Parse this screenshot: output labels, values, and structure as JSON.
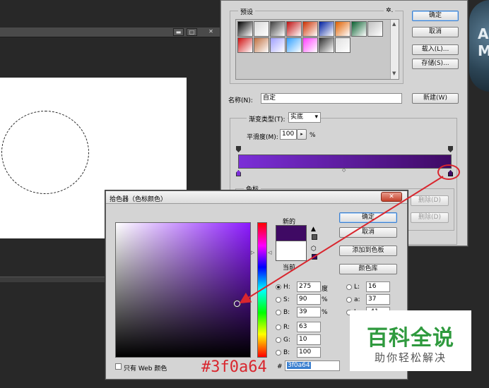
{
  "workspace": {
    "window_buttons": [
      "▬",
      "□",
      "✕"
    ]
  },
  "emblem": {
    "letters": "A M"
  },
  "gradient_editor": {
    "presets_label": "预设",
    "gear_symbol": "✲.",
    "buttons": {
      "ok": "确定",
      "cancel": "取消",
      "load": "载入(L)...",
      "save": "存储(S)...",
      "new": "新建(W)"
    },
    "name_label": "名称(N):",
    "name_value": "自定",
    "gradient_type_label": "渐变类型(T):",
    "gradient_type_value": "实底",
    "smoothness_label": "平滑度(M):",
    "smoothness_value": "100",
    "smoothness_unit": "%",
    "color_stops_label": "色标",
    "delete_label": "删除(D)",
    "swatches": [
      [
        "#000000",
        "#d8d8d8",
        "#404040",
        "#c01010",
        "#cc3000",
        "#0020a0",
        "#e06000",
        "#0a6030",
        "#c0c0c0"
      ],
      [
        "#d01010",
        "#c07040",
        "#a0a0ff",
        "#30a0ff",
        "#ff40ff",
        "#303030",
        "#e0e0e0"
      ]
    ]
  },
  "color_picker": {
    "title": "拾色器（色标颜色）",
    "close": "✕",
    "new_label": "新的",
    "current_label": "当前",
    "buttons": {
      "ok": "确定",
      "cancel": "取消",
      "add_swatch": "添加到色板",
      "libraries": "颜色库"
    },
    "hsb": [
      {
        "key": "H:",
        "value": "275",
        "unit": "度",
        "checked": true
      },
      {
        "key": "S:",
        "value": "90",
        "unit": "%",
        "checked": false
      },
      {
        "key": "B:",
        "value": "39",
        "unit": "%",
        "checked": false
      }
    ],
    "rgb": [
      {
        "key": "R:",
        "value": "63"
      },
      {
        "key": "G:",
        "value": "10"
      },
      {
        "key": "B:",
        "value": "100"
      }
    ],
    "lab": [
      {
        "key": "L:",
        "value": "16"
      },
      {
        "key": "a:",
        "value": "37"
      },
      {
        "key": "b:",
        "value": "-41"
      }
    ],
    "web_only_label": "只有 Web 颜色",
    "hex_prefix": "#",
    "hex_value": "3f0a64",
    "colors": {
      "new": "#3f0a64",
      "current": "#ffffff"
    }
  },
  "annotation": {
    "caption": "#3f0a64",
    "color": "#d9262e"
  },
  "watermark": {
    "main": "百科全说",
    "sub": "助你轻松解决"
  }
}
